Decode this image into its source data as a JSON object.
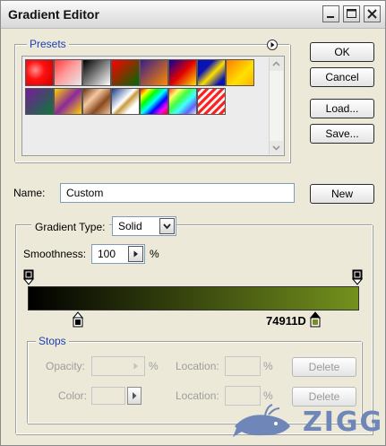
{
  "window": {
    "title": "Gradient Editor"
  },
  "presets": {
    "label": "Presets",
    "swatches": [
      {
        "name": "preset-red-transparent",
        "bg": "radial-gradient(circle at 35% 40%, #ff9090 0%, #ff1010 40%, #cc0000 100%)"
      },
      {
        "name": "preset-red-checker",
        "bg": "linear-gradient(135deg, #ff3a3a 0%, #ff9a9a 45%, #e8e8e8 100%)"
      },
      {
        "name": "preset-black-white",
        "bg": "linear-gradient(135deg, #000000 0%, #ffffff 100%)"
      },
      {
        "name": "preset-red-green",
        "bg": "linear-gradient(135deg, #ff0000 0%, #006a00 100%)"
      },
      {
        "name": "preset-violet-orange",
        "bg": "linear-gradient(135deg, #3a1d8a 0%, #ff8a00 100%)"
      },
      {
        "name": "preset-blue-red-yellow",
        "bg": "linear-gradient(135deg, #0a00a0 0%, #e00000 50%, #ffe000 100%)"
      },
      {
        "name": "preset-blue-yellow-blue",
        "bg": "linear-gradient(135deg, #0a12b5 0%, #0a12b5 30%, #ffe000 55%, #0a12b5 85%)"
      },
      {
        "name": "preset-orange-yellow",
        "bg": "linear-gradient(135deg, #ff7a00 0%, #ffe100 60%, #ffb000 100%)"
      },
      {
        "name": "preset-violet-green",
        "bg": "linear-gradient(135deg, #7a1a9a 0%, #0a7a3a 100%)"
      },
      {
        "name": "preset-yellow-violet",
        "bg": "linear-gradient(135deg, #ffd000 0%, #8a2a9a 50%, #ffd000 100%)"
      },
      {
        "name": "preset-copper",
        "bg": "linear-gradient(135deg, #6a3010 0%, #f5c8a0 35%, #8a4a20 65%, #f0c09a 100%)"
      },
      {
        "name": "preset-chrome",
        "bg": "linear-gradient(135deg, #1a3a8a 0%, #ffffff 45%, #c89a40 55%, #ffffff 75%)"
      },
      {
        "name": "preset-spectrum",
        "bg": "linear-gradient(135deg, #ff0000, #ffff00, #00ff00, #00ffff, #0000ff, #ff00ff, #ff0000)"
      },
      {
        "name": "preset-transparent-rainbow",
        "bg": "linear-gradient(135deg, #ff4040, #ffff60, #40ff40, #40ffff, #6060ff, #e0e0e0)"
      },
      {
        "name": "preset-transparent-stripes",
        "bg": "repeating-linear-gradient(135deg, #ff2020 0px, #ff2020 3px, #f4f4f4 3px, #f4f4f4 6px)"
      }
    ]
  },
  "buttons": {
    "ok": "OK",
    "cancel": "Cancel",
    "load": "Load...",
    "save": "Save...",
    "new": "New"
  },
  "name_field": {
    "label": "Name:",
    "value": "Custom"
  },
  "gradient_type": {
    "label": "Gradient Type:",
    "value": "Solid"
  },
  "smoothness": {
    "label": "Smoothness:",
    "value": "100",
    "unit": "%"
  },
  "gradient": {
    "start_color": "#000000",
    "end_color": "#74911d",
    "end_color_label": "74911D"
  },
  "stops": {
    "label": "Stops",
    "opacity_label": "Opacity:",
    "opacity_unit": "%",
    "opacity_location_label": "Location:",
    "opacity_location_unit": "%",
    "opacity_delete": "Delete",
    "color_label": "Color:",
    "color_location_label": "Location:",
    "color_location_unit": "%",
    "color_delete": "Delete"
  },
  "watermark": {
    "text": "ZIGG"
  },
  "colors": {
    "legend_blue": "#1a3fb5",
    "window_bg": "#ece9d8"
  }
}
